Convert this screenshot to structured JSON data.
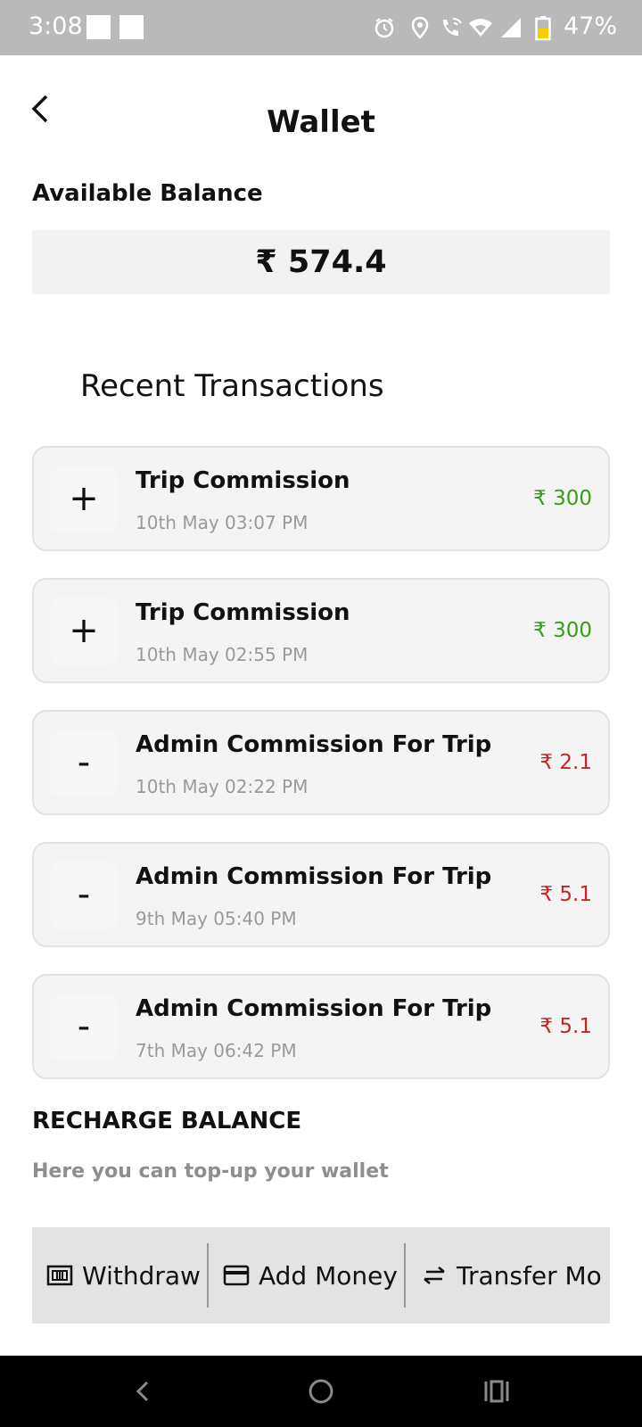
{
  "status_bar": {
    "time": "3:08",
    "battery": "47%"
  },
  "header": {
    "title": "Wallet",
    "back_icon": "chevron-left-icon"
  },
  "balance": {
    "label": "Available Balance",
    "amount": "₹ 574.4"
  },
  "recent": {
    "title": "Recent Transactions",
    "items": [
      {
        "sign": "+",
        "title": "Trip Commission",
        "date": "10th May 03:07 PM",
        "amount": "₹ 300",
        "type": "credit"
      },
      {
        "sign": "+",
        "title": "Trip Commission",
        "date": "10th May 02:55 PM",
        "amount": "₹ 300",
        "type": "credit"
      },
      {
        "sign": "-",
        "title": "Admin Commission For Trip",
        "date": "10th May 02:22 PM",
        "amount": "₹ 2.1",
        "type": "debit"
      },
      {
        "sign": "-",
        "title": "Admin Commission For Trip",
        "date": "9th May 05:40 PM",
        "amount": "₹ 5.1",
        "type": "debit"
      },
      {
        "sign": "-",
        "title": "Admin Commission For Trip",
        "date": "7th May 06:42 PM",
        "amount": "₹ 5.1",
        "type": "debit"
      }
    ]
  },
  "recharge": {
    "title": "RECHARGE BALANCE",
    "subtitle": "Here you can top-up your wallet"
  },
  "actions": {
    "withdraw": "Withdraw",
    "add_money": "Add Money",
    "transfer": "Transfer Mo"
  },
  "colors": {
    "credit": "#3a9a1a",
    "debit": "#cc2222",
    "status_bar": "#b9b9b9",
    "action_bar": "#e3e3e3"
  }
}
